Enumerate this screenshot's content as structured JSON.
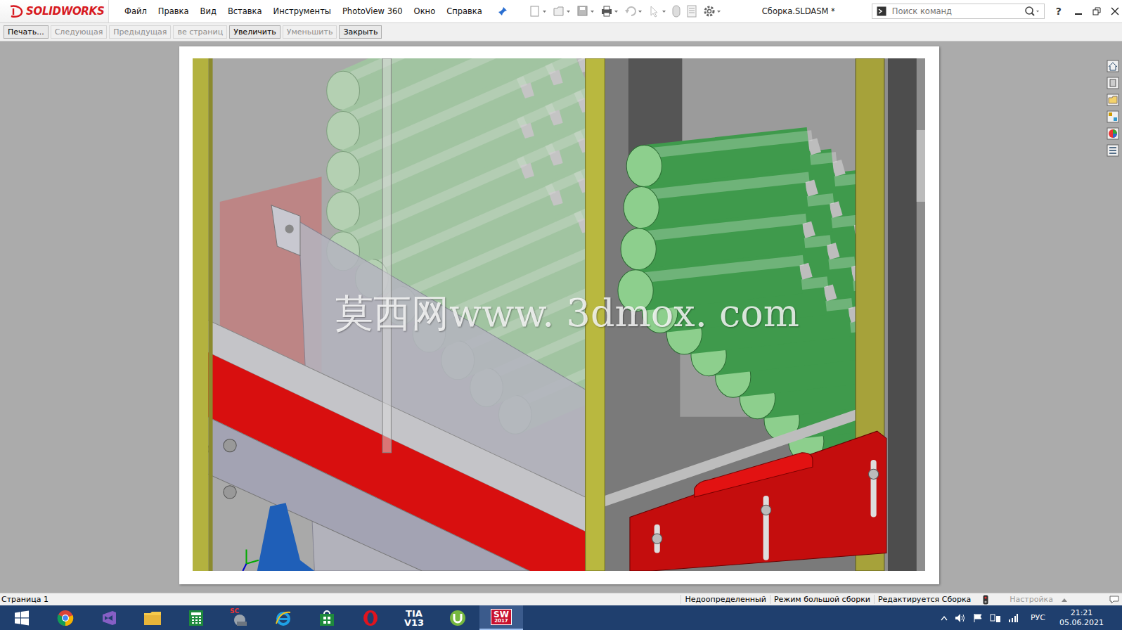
{
  "app": {
    "logo": "SOLIDWORKS"
  },
  "menu": [
    {
      "label": "Файл"
    },
    {
      "label": "Правка"
    },
    {
      "label": "Вид"
    },
    {
      "label": "Вставка"
    },
    {
      "label": "Инструменты"
    },
    {
      "label": "PhotoView 360"
    },
    {
      "label": "Окно"
    },
    {
      "label": "Справка"
    }
  ],
  "window": {
    "title": "Сборка.SLDASM *"
  },
  "search": {
    "placeholder": "Поиск команд"
  },
  "help": "?",
  "preview_toolbar": [
    {
      "label": "Печать...",
      "disabled": false
    },
    {
      "label": "Следующая",
      "disabled": true
    },
    {
      "label": "Предыдущая",
      "disabled": true
    },
    {
      "label": "ве страниц",
      "disabled": true
    },
    {
      "label": "Увеличить",
      "disabled": false
    },
    {
      "label": "Уменьшить",
      "disabled": true
    },
    {
      "label": "Закрыть",
      "disabled": false
    }
  ],
  "watermark": "莫西网www. 3dmox. com",
  "status_bar": {
    "page": "Страница 1",
    "items": [
      "Недоопределенный",
      "Режим большой сборки",
      "Редактируется Сборка"
    ],
    "settings": {
      "label": "Настройка",
      "disabled": true
    }
  },
  "taskbar": {
    "apps": [
      {
        "kind": "start",
        "active": false
      },
      {
        "kind": "chrome",
        "active": false
      },
      {
        "kind": "vs",
        "active": false
      },
      {
        "kind": "explorer",
        "active": false
      },
      {
        "kind": "calc",
        "active": false
      },
      {
        "kind": "sc",
        "active": false,
        "label": "SC"
      },
      {
        "kind": "ie",
        "active": false
      },
      {
        "kind": "store",
        "active": false
      },
      {
        "kind": "opera",
        "active": false
      },
      {
        "kind": "tia",
        "active": false,
        "label": "TIA",
        "sublabel": "V13"
      },
      {
        "kind": "utorrent",
        "active": false
      },
      {
        "kind": "sw",
        "active": true,
        "label": "SW",
        "sublabel": "2017"
      }
    ],
    "language": "РУС",
    "time": "21:21",
    "date": "05.06.2021"
  }
}
